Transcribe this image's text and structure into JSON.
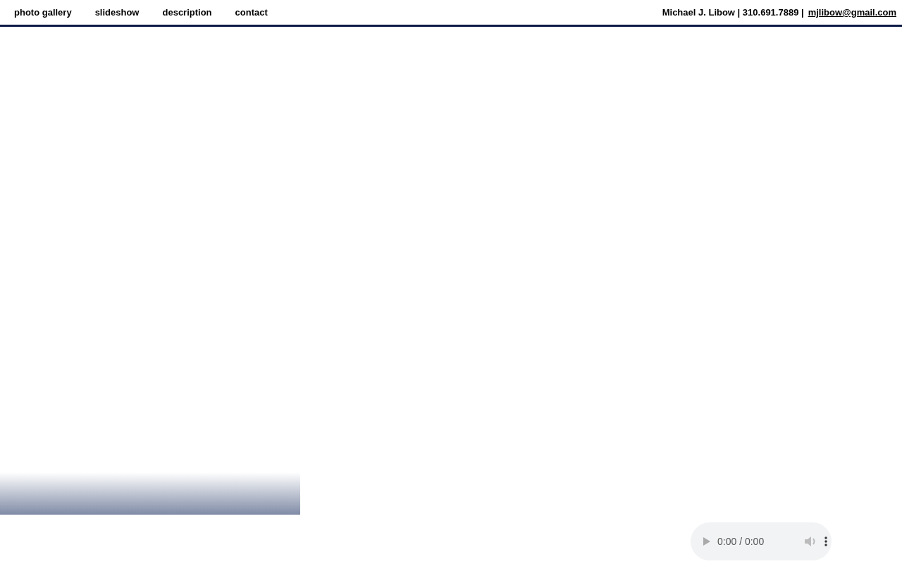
{
  "nav": [
    {
      "label": "photo gallery"
    },
    {
      "label": "slideshow"
    },
    {
      "label": "description"
    },
    {
      "label": "contact"
    }
  ],
  "contact": {
    "name_phone": "Michael J. Libow | 310.691.7889 |",
    "email": "mjlibow@gmail.com"
  },
  "audio_player": {
    "time": "0:00 / 0:00"
  }
}
